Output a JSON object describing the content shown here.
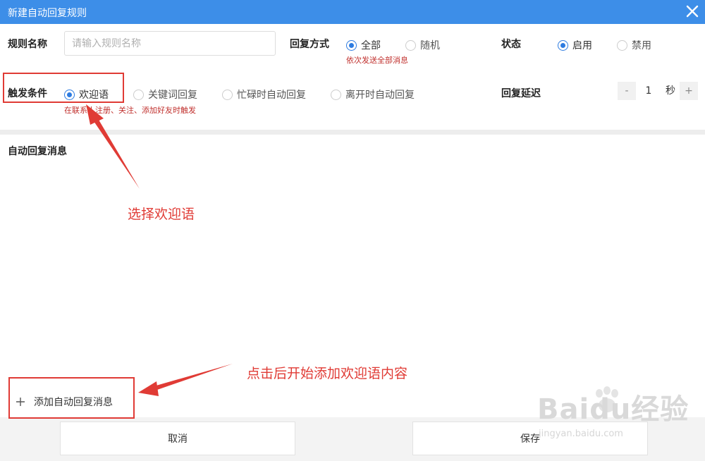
{
  "window": {
    "title": "新建自动回复规则"
  },
  "rule_name": {
    "label": "规则名称",
    "placeholder": "请输入规则名称",
    "value": ""
  },
  "reply_method": {
    "label": "回复方式",
    "options": [
      "全部",
      "随机"
    ],
    "selected": "全部",
    "hint": "依次发送全部消息"
  },
  "status": {
    "label": "状态",
    "options": [
      "启用",
      "禁用"
    ],
    "selected": "启用"
  },
  "trigger": {
    "label": "触发条件",
    "options": [
      "欢迎语",
      "关键词回复",
      "忙碌时自动回复",
      "离开时自动回复"
    ],
    "selected": "欢迎语",
    "hint": "在联系人注册、关注、添加好友时触发"
  },
  "reply_delay": {
    "label": "回复延迟",
    "minus": "-",
    "value": "1",
    "unit": "秒",
    "plus": "+"
  },
  "auto_reply": {
    "section_title": "自动回复消息",
    "add_label": "添加自动回复消息"
  },
  "footer": {
    "cancel": "取消",
    "save": "保存"
  },
  "annotations": {
    "select_welcome": "选择欢迎语",
    "click_add": "点击后开始添加欢迎语内容"
  },
  "watermark": {
    "brand": "Baidu经验",
    "url": "jingyan.baidu.com"
  },
  "colors": {
    "titlebar": "#3d8ee8",
    "radio": "#2d7be0",
    "hint": "#c0302d",
    "annotation": "#e03b35"
  },
  "icons": {
    "close": "close-icon",
    "add": "plus-icon"
  }
}
